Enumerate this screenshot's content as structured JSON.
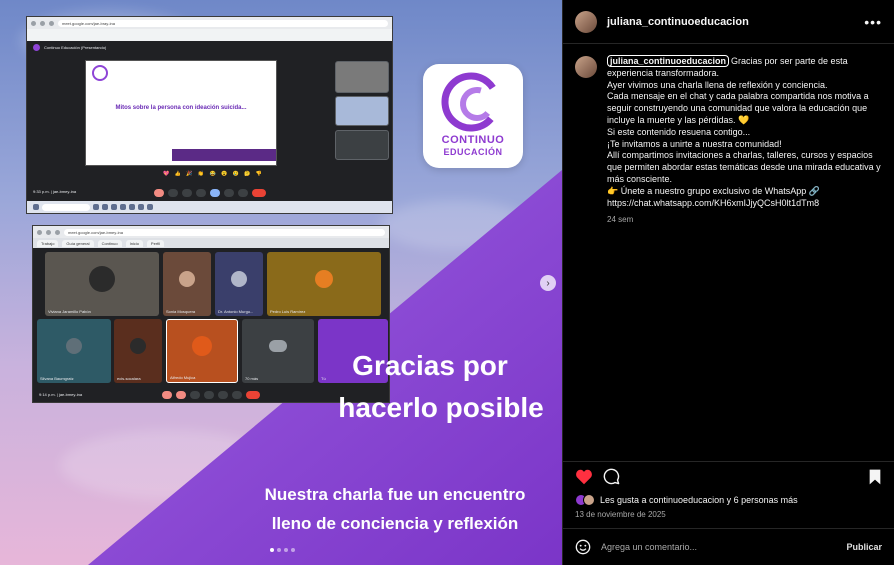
{
  "post": {
    "username": "juliana_continuoeducacion",
    "caption_user": "juliana_continuoeducacion",
    "caption_lines": [
      "Gracias por ser parte de esta experiencia transformadora.",
      "Ayer vivimos una charla llena de reflexión y conciencia.",
      "Cada mensaje en el chat y cada palabra compartida nos motiva a seguir construyendo una comunidad que valora la educación que incluye la muerte y las pérdidas. 💛",
      "Si este contenido resuena contigo...",
      "¡Te invitamos a unirte a nuestra comunidad!",
      "Allí compartimos invitaciones a charlas, talleres, cursos y espacios que permiten abordar estas temáticas desde una mirada educativa y más consciente.",
      "👉 Únete a nuestro grupo exclusivo de WhatsApp 🔗",
      "https://chat.whatsapp.com/KH6xmIJjyQCsH0lt1dTm8"
    ],
    "age": "24 sem",
    "likes_text": "Les gusta a continuoeducacion y 6 personas más",
    "date": "13 de noviembre de 2025",
    "comment_placeholder": "Agrega un comentario...",
    "publish_label": "Publicar"
  },
  "media": {
    "heading_line1": "Gracias por",
    "heading_line2": "hacerlo posible",
    "sub_line1": "Nuestra charla fue un encuentro",
    "sub_line2": "lleno de conciencia y reflexión",
    "logo_line1": "CONTINUO",
    "logo_line2": "EDUCACIÓN",
    "slide_title": "Mitos sobre  la persona con ideación suicida...",
    "meet_title": "Continuo Educación (Presentando)",
    "url_top": "meet.google.com/jae-bray-ina",
    "url_bottom": "meet.google.com/jae-bmey-ina",
    "time_top": "9:33 p.m.  |  jae-bmey-ina",
    "time_bottom": "9:14 p.m.  |  jae-bmey-ina",
    "emojis": "💖 👍 🎉 👏 😂 😮 😢 🤔 👎",
    "participants": [
      "Viviana Jaramillo Pabón",
      "Sonia Mosquera",
      "Dr. Antonio Murgu...",
      "Pedro Luis Ramírez",
      "Silvana Baumgratz",
      "ecis-socalara",
      "Alfredo Mujica",
      "70 más",
      "Tú"
    ],
    "active_dot_index": 0
  },
  "colors": {
    "accent_purple": "#8e3ad0",
    "like_red": "#ff3040",
    "meet_red": "#ea4335"
  }
}
